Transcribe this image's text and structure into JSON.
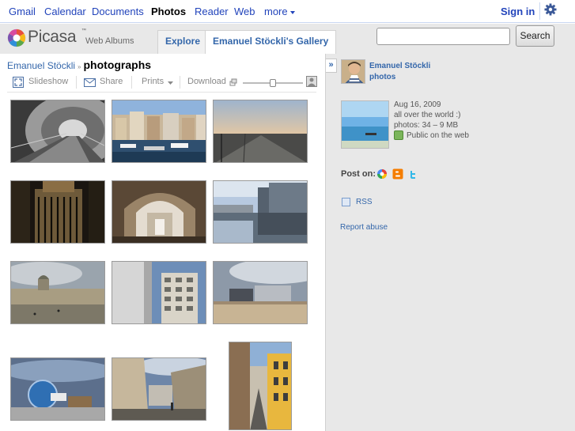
{
  "gbar": {
    "links": [
      "Gmail",
      "Calendar",
      "Documents",
      "Photos",
      "Reader",
      "Web",
      "more"
    ],
    "active": "Photos",
    "signin": "Sign in",
    "settings_icon": "gear-icon"
  },
  "header": {
    "logo_text": "Picasa",
    "logo_tm": "™",
    "logo_sub": "Web Albums",
    "tabs": [
      "Explore",
      "Emanuel Stöckli's Gallery"
    ],
    "search": {
      "value": "",
      "placeholder": ""
    },
    "search_button": "Search"
  },
  "breadcrumb": {
    "user": "Emanuel Stöckli",
    "separator": "»",
    "album": "photographs"
  },
  "toolbar": {
    "slideshow": "Slideshow",
    "share": "Share",
    "prints": "Prints",
    "download": "Download",
    "zoom_level": 0.5
  },
  "photos": [
    {
      "name": "tunnel-escalator",
      "orientation": "landscape"
    },
    {
      "name": "harbor-town",
      "orientation": "landscape"
    },
    {
      "name": "sunset-pier",
      "orientation": "landscape"
    },
    {
      "name": "dark-gate",
      "orientation": "landscape"
    },
    {
      "name": "stone-arches",
      "orientation": "landscape"
    },
    {
      "name": "reflection-building",
      "orientation": "landscape"
    },
    {
      "name": "palace-cloudy",
      "orientation": "landscape"
    },
    {
      "name": "tall-building",
      "orientation": "landscape"
    },
    {
      "name": "modern-square",
      "orientation": "landscape"
    },
    {
      "name": "blue-dome",
      "orientation": "landscape"
    },
    {
      "name": "old-street",
      "orientation": "landscape"
    },
    {
      "name": "narrow-alley",
      "orientation": "portrait"
    }
  ],
  "sidebar": {
    "owner_name": "Emanuel Stöckli",
    "owner_photos": "photos",
    "date": "Aug 16, 2009",
    "location": "all over the world :)",
    "stats": "photos: 34 – 9 MB",
    "visibility": "Public on the web",
    "post_on": "Post on:",
    "rss": "RSS",
    "report": "Report abuse"
  },
  "colors": {
    "link": "#3366aa",
    "header_bg": "#e8e8e8",
    "google_link": "#2244bb"
  }
}
